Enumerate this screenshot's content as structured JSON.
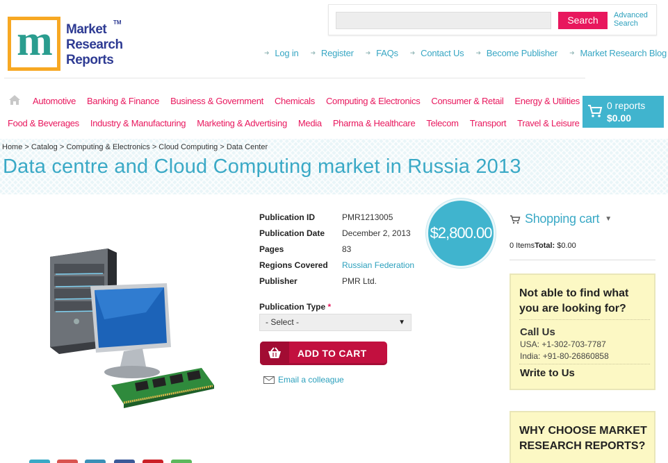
{
  "logo": {
    "line1": "Market",
    "line2": "Research",
    "line3": "Reports",
    "tm": "TM"
  },
  "search": {
    "placeholder": "",
    "button": "Search",
    "advanced_line1": "Advanced",
    "advanced_line2": "Search"
  },
  "toplinks": [
    "Log in",
    "Register",
    "FAQs",
    "Contact Us",
    "Become Publisher",
    "Market Research Blog"
  ],
  "categories_row1": [
    "Automotive",
    "Banking & Finance",
    "Business & Government",
    "Chemicals",
    "Computing & Electronics",
    "Consumer & Retail",
    "Energy & Utilities"
  ],
  "categories_row2": [
    "Food & Beverages",
    "Industry & Manufacturing",
    "Marketing & Advertising",
    "Media",
    "Pharma & Healthcare",
    "Telecom",
    "Transport",
    "Travel & Leisure"
  ],
  "cart_box": {
    "reports": "0 reports",
    "total": "$0.00"
  },
  "breadcrumb": "Home > Catalog > Computing & Electronics > Cloud Computing > Data Center",
  "title": "Data centre and Cloud Computing market in Russia 2013",
  "details": [
    {
      "label": "Publication ID",
      "value": "PMR1213005",
      "link": false
    },
    {
      "label": "Publication Date",
      "value": "December 2, 2013",
      "link": false
    },
    {
      "label": "Pages",
      "value": "83",
      "link": false
    },
    {
      "label": "Regions Covered",
      "value": "Russian Federation",
      "link": true
    },
    {
      "label": "Publisher",
      "value": "PMR Ltd.",
      "link": false
    }
  ],
  "price": "$2,800.00",
  "publication_type": {
    "label": "Publication Type",
    "required_mark": "*",
    "selected": "- Select -"
  },
  "add_to_cart": "ADD TO CART",
  "email_colleague": "Email a colleague",
  "shopping_cart": {
    "heading": "Shopping cart",
    "items": "0 Items",
    "total_label": "Total:",
    "total_value": "$0.00"
  },
  "help_box": {
    "question": "Not able to find what you are looking for?",
    "call_us": "Call Us",
    "usa": "USA: +1-302-703-7787",
    "india": "India: +91-80-26860858",
    "write_to_us": "Write to Us"
  },
  "why_box": {
    "title": "WHY CHOOSE MARKET RESEARCH REPORTS?"
  },
  "colors": {
    "accent_blue": "#40b4ce",
    "accent_pink": "#e8175d",
    "add_to_cart": "#c2103f",
    "help_bg": "#fcf8c4"
  }
}
